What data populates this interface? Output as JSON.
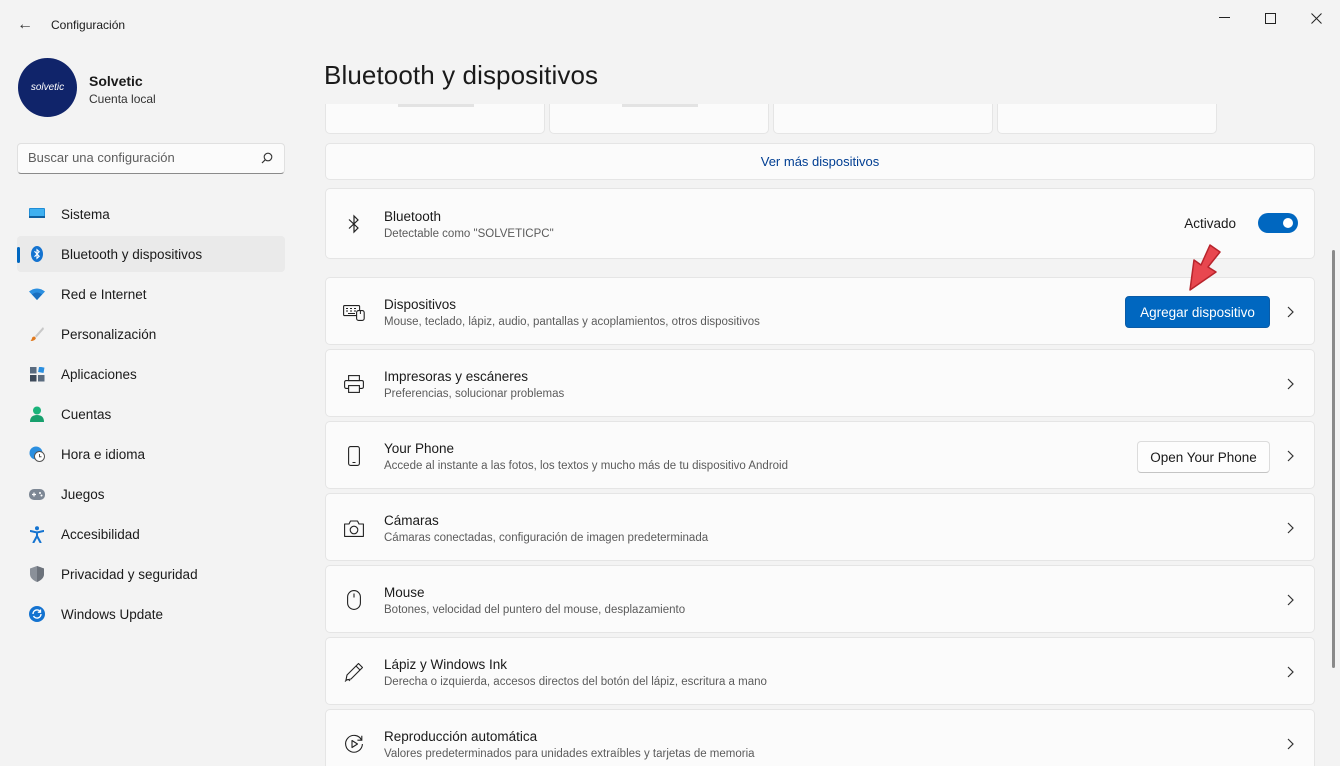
{
  "window": {
    "title": "Configuración",
    "back_glyph": "←",
    "minimize_glyph": "—",
    "maximize_glyph": "☐",
    "close_glyph": "✕"
  },
  "profile": {
    "name": "Solvetic",
    "account_type": "Cuenta local",
    "avatar_text": "solvetic"
  },
  "search": {
    "placeholder": "Buscar una configuración"
  },
  "sidebar": {
    "items": [
      {
        "label": "Sistema",
        "icon": "monitor-icon",
        "active": false
      },
      {
        "label": "Bluetooth y dispositivos",
        "icon": "bluetooth-icon",
        "active": true
      },
      {
        "label": "Red e Internet",
        "icon": "wifi-icon",
        "active": false
      },
      {
        "label": "Personalización",
        "icon": "brush-icon",
        "active": false
      },
      {
        "label": "Aplicaciones",
        "icon": "apps-icon",
        "active": false
      },
      {
        "label": "Cuentas",
        "icon": "person-icon",
        "active": false
      },
      {
        "label": "Hora e idioma",
        "icon": "globe-clock-icon",
        "active": false
      },
      {
        "label": "Juegos",
        "icon": "gamepad-icon",
        "active": false
      },
      {
        "label": "Accesibilidad",
        "icon": "accessibility-icon",
        "active": false
      },
      {
        "label": "Privacidad y seguridad",
        "icon": "shield-icon",
        "active": false
      },
      {
        "label": "Windows Update",
        "icon": "update-icon",
        "active": false
      }
    ]
  },
  "main": {
    "title": "Bluetooth y dispositivos",
    "see_more": "Ver más dispositivos",
    "bluetooth": {
      "title": "Bluetooth",
      "subtitle": "Detectable como \"SOLVETICPC\"",
      "state_label": "Activado",
      "enabled": true
    },
    "rows": [
      {
        "title": "Dispositivos",
        "subtitle": "Mouse, teclado, lápiz, audio, pantallas y acoplamientos, otros dispositivos",
        "icon": "devices-icon",
        "action": "Agregar dispositivo"
      },
      {
        "title": "Impresoras y escáneres",
        "subtitle": "Preferencias, solucionar problemas",
        "icon": "printer-icon"
      },
      {
        "title": "Your Phone",
        "subtitle": "Accede al instante a las fotos, los textos y mucho más de tu dispositivo Android",
        "icon": "phone-icon",
        "action": "Open Your Phone"
      },
      {
        "title": "Cámaras",
        "subtitle": "Cámaras conectadas, configuración de imagen predeterminada",
        "icon": "camera-icon"
      },
      {
        "title": "Mouse",
        "subtitle": "Botones, velocidad del puntero del mouse, desplazamiento",
        "icon": "mouse-icon"
      },
      {
        "title": "Lápiz y Windows Ink",
        "subtitle": "Derecha o izquierda, accesos directos del botón del lápiz, escritura a mano",
        "icon": "pen-icon"
      },
      {
        "title": "Reproducción automática",
        "subtitle": "Valores predeterminados para unidades extraíbles y tarjetas de memoria",
        "icon": "autoplay-icon"
      }
    ]
  },
  "colors": {
    "accent": "#0067c0",
    "annotation_arrow": "#e8474f",
    "avatar_bg": "#10246a"
  }
}
